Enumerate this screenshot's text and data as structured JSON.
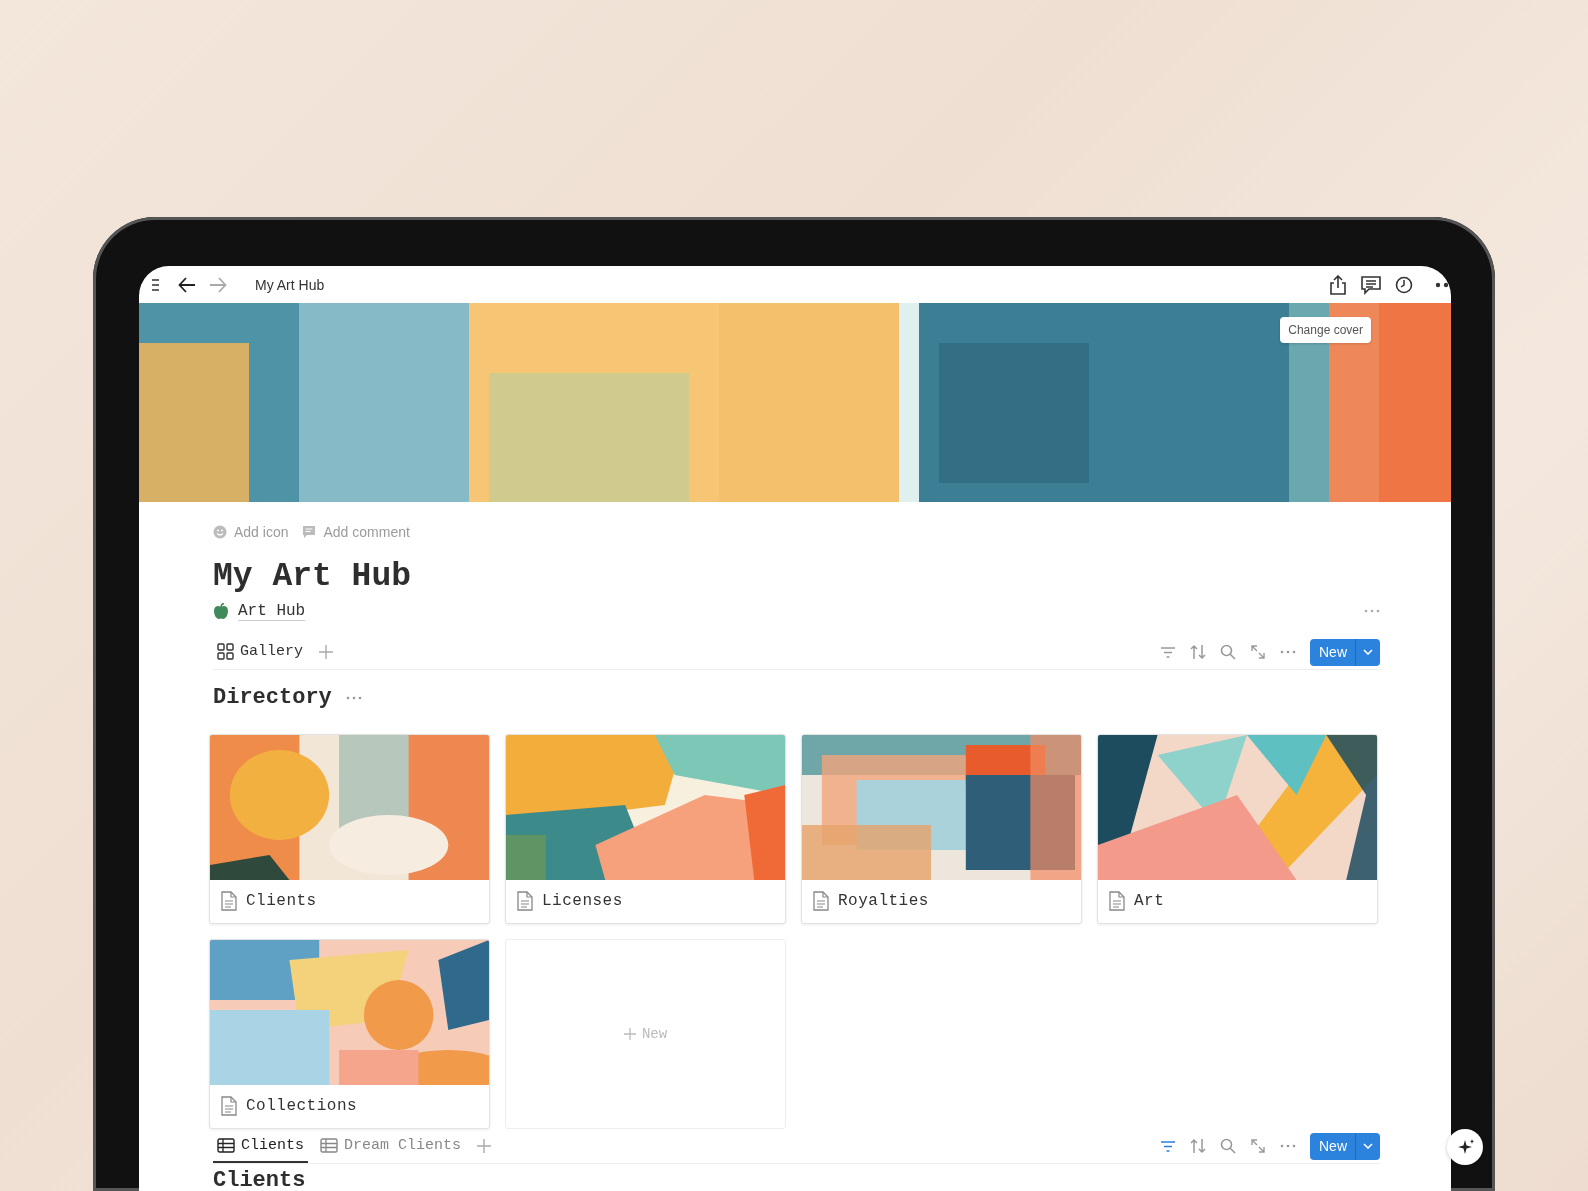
{
  "topbar": {
    "title": "My Art Hub",
    "back_disabled": false,
    "forward_disabled": true
  },
  "cover": {
    "kind": "picture",
    "button": "Change cover"
  },
  "page_actions": [
    {
      "kind": "icon",
      "label": "Add icon"
    },
    {
      "kind": "comment",
      "label": "Add comment"
    }
  ],
  "title": "My Art Hub",
  "breadcrumb": {
    "label": "Art Hub"
  },
  "gallery_views": {
    "tabs": [
      {
        "label": "Gallery",
        "kind": "gallery",
        "selected": false
      }
    ],
    "filter_active": false,
    "new_button": "New"
  },
  "directory": {
    "title": "Directory",
    "cards": [
      {
        "label": "Clients",
        "kind": "picture"
      },
      {
        "label": "Licenses",
        "kind": "picture"
      },
      {
        "label": "Royalties",
        "kind": "picture"
      },
      {
        "label": "Art",
        "kind": "picture"
      },
      {
        "label": "Collections",
        "kind": "picture"
      }
    ],
    "new_card": "New"
  },
  "table_views": {
    "tabs": [
      {
        "label": "Clients",
        "kind": "table",
        "selected": true
      },
      {
        "label": "Dream Clients",
        "kind": "table",
        "selected": false
      }
    ],
    "filter_active": true,
    "new_button": "New"
  },
  "section_title": "Clients"
}
